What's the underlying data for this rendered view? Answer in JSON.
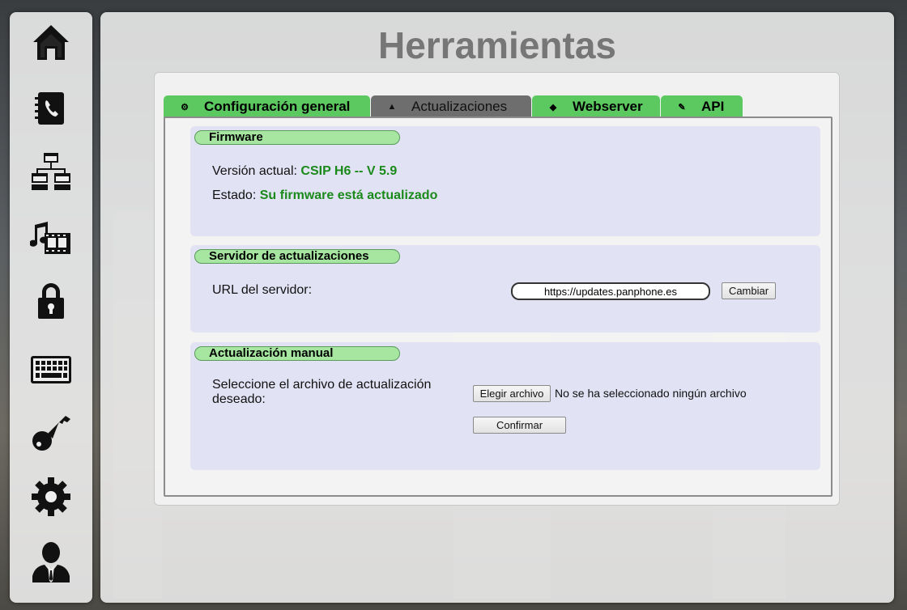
{
  "page": {
    "title": "Herramientas"
  },
  "sidebar": {
    "items": [
      {
        "icon": "home-icon"
      },
      {
        "icon": "phonebook-icon"
      },
      {
        "icon": "network-icon"
      },
      {
        "icon": "media-icon"
      },
      {
        "icon": "lock-icon"
      },
      {
        "icon": "keyboard-icon"
      },
      {
        "icon": "key-icon"
      },
      {
        "icon": "gear-icon"
      },
      {
        "icon": "user-icon"
      }
    ]
  },
  "tabs": [
    {
      "label": "Configuración general",
      "icon": "gear-icon",
      "active": false
    },
    {
      "label": "Actualizaciones",
      "icon": "upload-icon",
      "active": true
    },
    {
      "label": "Webserver",
      "icon": "shield-icon",
      "active": false
    },
    {
      "label": "API",
      "icon": "wrench-icon",
      "active": false
    }
  ],
  "firmware": {
    "header": "Firmware",
    "version_label": "Versión actual:",
    "version_value": "CSIP H6 -- V 5.9",
    "status_label": "Estado:",
    "status_value": "Su firmware está actualizado"
  },
  "update_server": {
    "header": "Servidor de actualizaciones",
    "url_label": "URL del servidor:",
    "url_value": "https://updates.panphone.es",
    "change_button": "Cambiar"
  },
  "manual_update": {
    "header": "Actualización manual",
    "file_label": "Seleccione el archivo de actualización deseado:",
    "choose_button": "Elegir archivo",
    "no_file_text": "No se ha seleccionado ningún archivo",
    "confirm_button": "Confirmar"
  },
  "colors": {
    "tab_green": "#5cc860",
    "tab_active": "#6e6e6e",
    "header_green": "#a6e6a0",
    "value_green": "#1a8a1a"
  }
}
